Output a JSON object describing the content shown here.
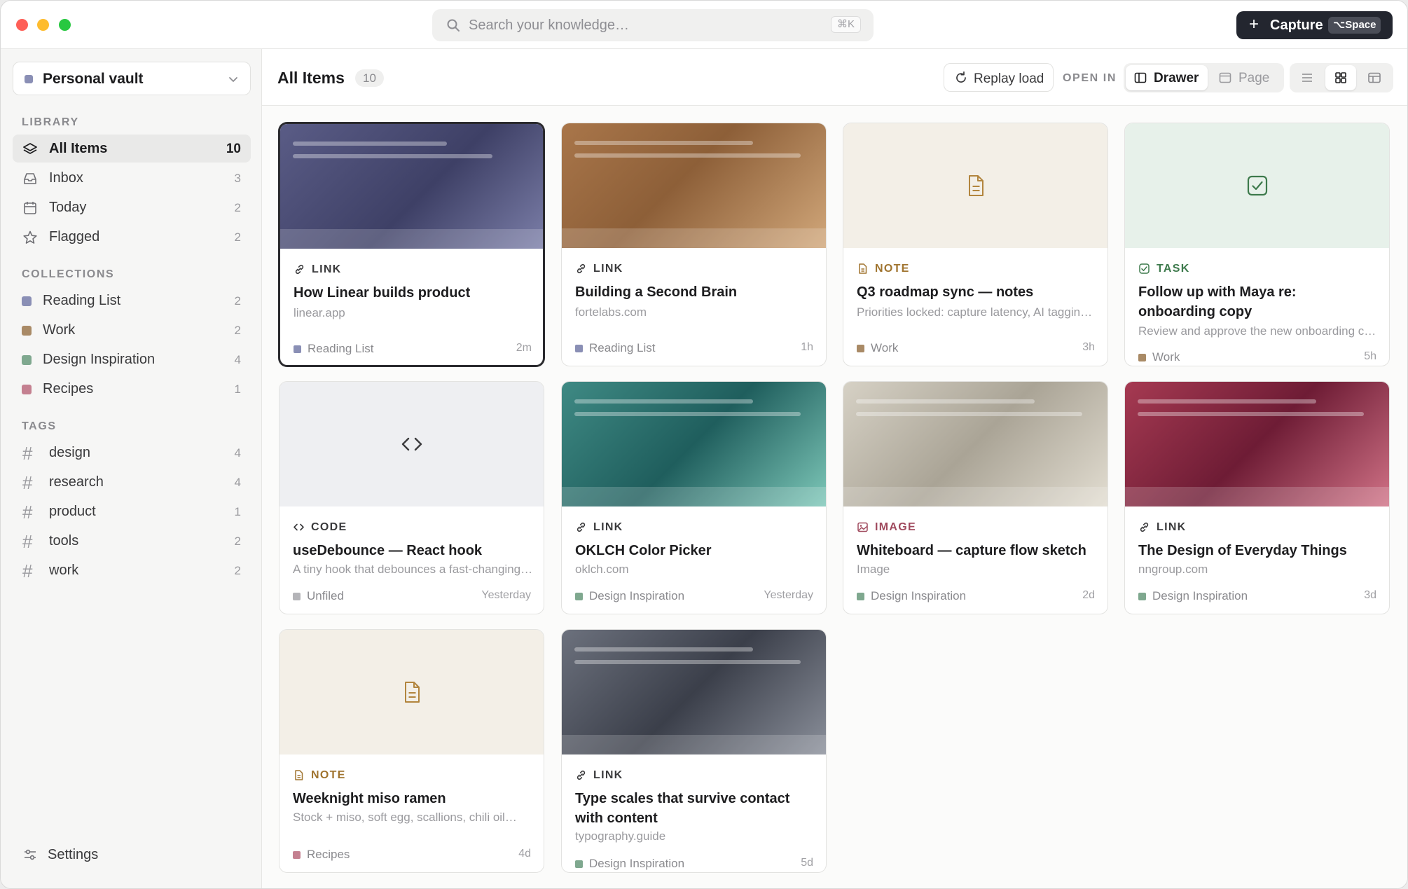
{
  "search": {
    "placeholder": "Search your knowledge…",
    "shortcut": "⌘K"
  },
  "capture": {
    "label": "Capture",
    "shortcut": "⌥Space"
  },
  "sidebar": {
    "vault_name": "Personal vault",
    "library_heading": "LIBRARY",
    "library": [
      {
        "label": "All Items",
        "count": "10",
        "icon": "layers-icon"
      },
      {
        "label": "Inbox",
        "count": "3",
        "icon": "inbox-icon"
      },
      {
        "label": "Today",
        "count": "2",
        "icon": "calendar-icon"
      },
      {
        "label": "Flagged",
        "count": "2",
        "icon": "star-icon"
      }
    ],
    "collections_heading": "COLLECTIONS",
    "collections": [
      {
        "label": "Reading List",
        "count": "2",
        "color": "#8a8fb5"
      },
      {
        "label": "Work",
        "count": "2",
        "color": "#a98a66"
      },
      {
        "label": "Design Inspiration",
        "count": "4",
        "color": "#7fa88f"
      },
      {
        "label": "Recipes",
        "count": "1",
        "color": "#c48090"
      }
    ],
    "tags_heading": "TAGS",
    "tags": [
      {
        "label": "design",
        "count": "4"
      },
      {
        "label": "research",
        "count": "4"
      },
      {
        "label": "product",
        "count": "1"
      },
      {
        "label": "tools",
        "count": "2"
      },
      {
        "label": "work",
        "count": "2"
      }
    ],
    "settings_label": "Settings"
  },
  "header": {
    "title": "All Items",
    "count": "10",
    "replay_label": "Replay load",
    "open_in_label": "OPEN IN",
    "drawer_label": "Drawer",
    "page_label": "Page"
  },
  "cards": [
    {
      "type": "LINK",
      "title": "How Linear builds product",
      "subtitle": "linear.app",
      "collection": "Reading List",
      "time": "2m"
    },
    {
      "type": "LINK",
      "title": "Building a Second Brain",
      "subtitle": "fortelabs.com",
      "collection": "Reading List",
      "time": "1h"
    },
    {
      "type": "NOTE",
      "title": "Q3 roadmap sync — notes",
      "subtitle": "Priorities locked: capture latency, AI tagging…",
      "collection": "Work",
      "time": "3h"
    },
    {
      "type": "TASK",
      "title": "Follow up with Maya re: onboarding copy",
      "subtitle": "Review and approve the new onboarding copy…",
      "collection": "Work",
      "time": "5h"
    },
    {
      "type": "CODE",
      "title": "useDebounce — React hook",
      "subtitle": "A tiny hook that debounces a fast-changing value…",
      "collection": "Unfiled",
      "time": "Yesterday"
    },
    {
      "type": "LINK",
      "title": "OKLCH Color Picker",
      "subtitle": "oklch.com",
      "collection": "Design Inspiration",
      "time": "Yesterday"
    },
    {
      "type": "IMAGE",
      "title": "Whiteboard — capture flow sketch",
      "subtitle": "Image",
      "collection": "Design Inspiration",
      "time": "2d"
    },
    {
      "type": "LINK",
      "title": "The Design of Everyday Things",
      "subtitle": "nngroup.com",
      "collection": "Design Inspiration",
      "time": "3d"
    },
    {
      "type": "NOTE",
      "title": "Weeknight miso ramen",
      "subtitle": "Stock + miso, soft egg, scallions, chili oil…",
      "collection": "Recipes",
      "time": "4d"
    },
    {
      "type": "LINK",
      "title": "Type scales that survive contact with content",
      "subtitle": "typography.guide",
      "collection": "Design Inspiration",
      "time": "5d"
    }
  ],
  "colors": {
    "link_label": "#3a3a3c",
    "note_label": "#a0742f",
    "task_label": "#3d7a4c",
    "image_label": "#a04a5e",
    "code_label": "#3a3a3c"
  }
}
